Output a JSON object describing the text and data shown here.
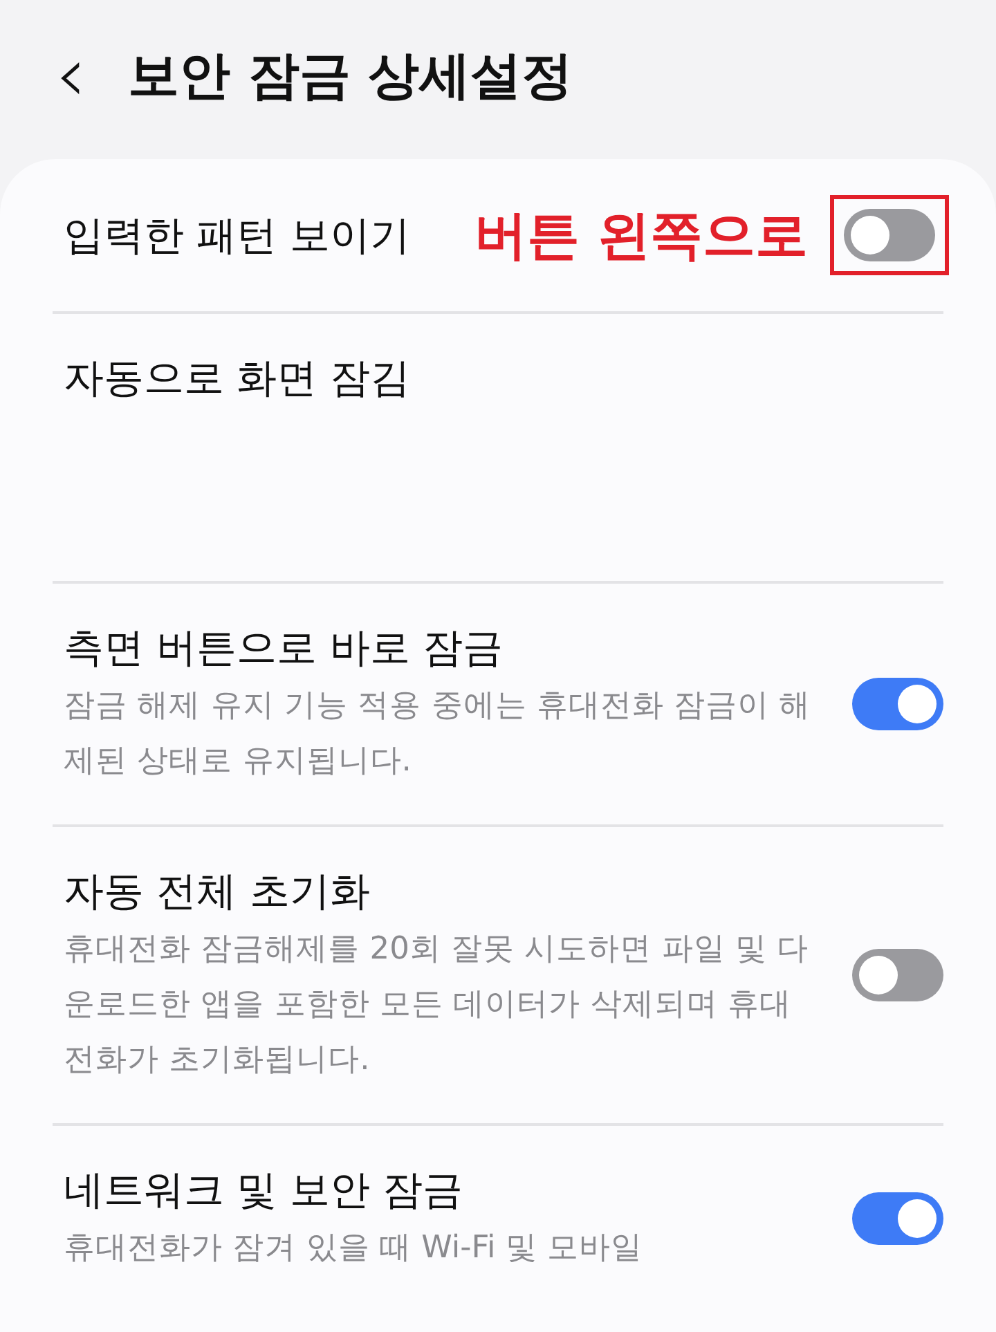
{
  "header": {
    "back_icon": "‹",
    "title": "보안 잠금 상세설정"
  },
  "settings": [
    {
      "title": "입력한 패턴 보이기",
      "on": false,
      "annotation": "버튼 왼쪽으로"
    },
    {
      "title": "자동으로 화면 잠김"
    },
    {
      "title": "측면 버튼으로 바로 잠금",
      "description": "잠금 해제 유지 기능 적용 중에는 휴대전화 잠금이 해제된 상태로 유지됩니다.",
      "on": true
    },
    {
      "title": "자동 전체 초기화",
      "description": "휴대전화 잠금해제를 20회 잘못 시도하면 파일 및 다운로드한 앱을 포함한 모든 데이터가 삭제되며 휴대전화가 초기화됩니다.",
      "on": false
    },
    {
      "title": "네트워크 및 보안 잠금",
      "description": "휴대전화가 잠겨 있을 때 Wi-Fi 및 모바일",
      "on": true
    }
  ]
}
